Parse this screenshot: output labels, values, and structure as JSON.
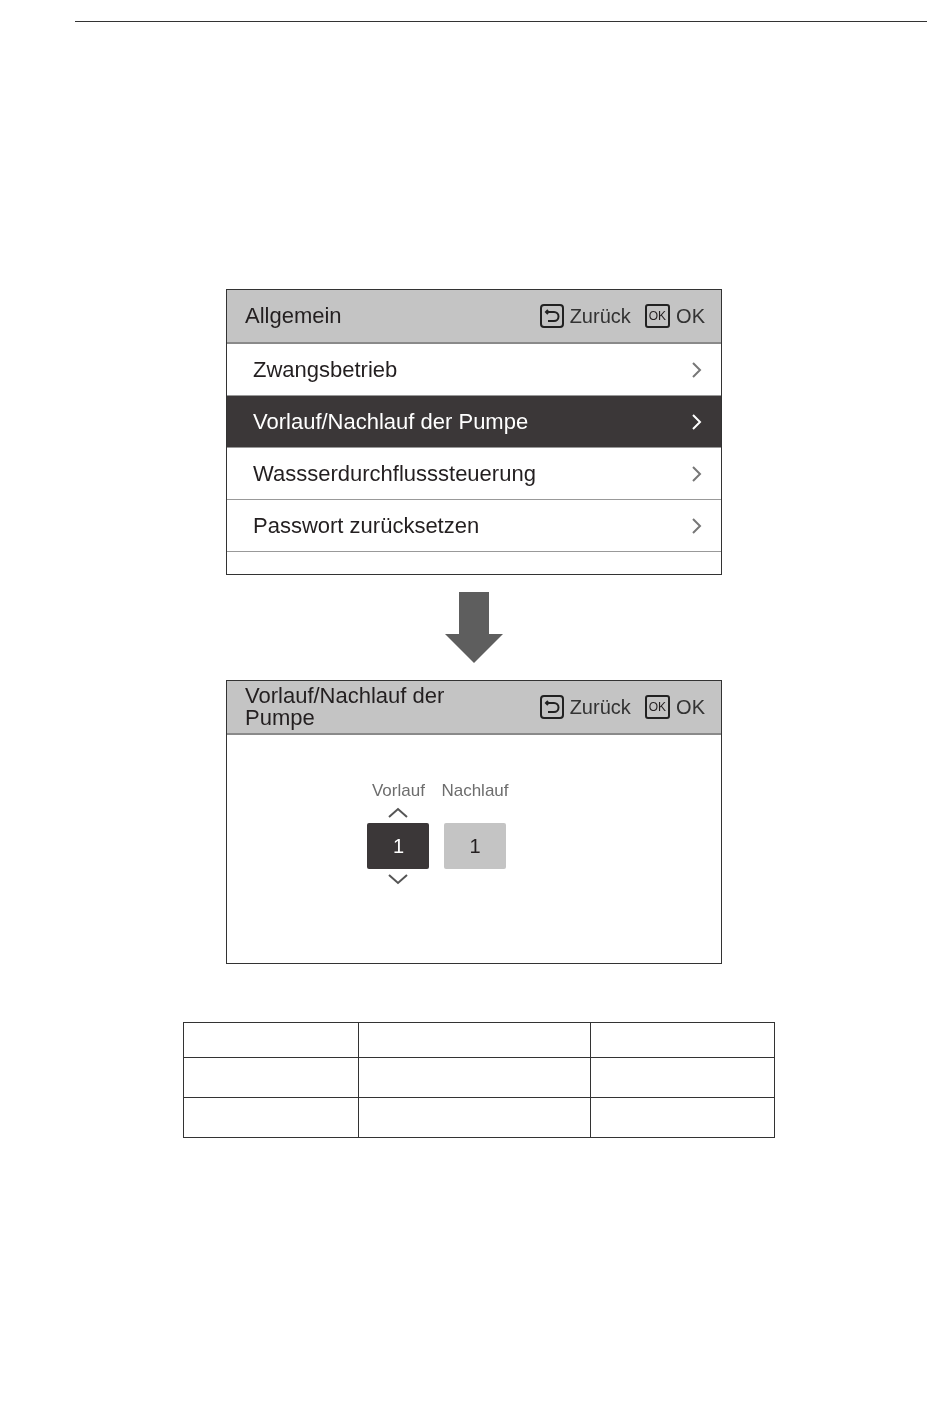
{
  "screens": [
    {
      "title": "Allgemein",
      "actions": [
        {
          "kind": "back",
          "label": "Zurück"
        },
        {
          "kind": "ok",
          "key": "OK",
          "label": "OK"
        }
      ],
      "menu": [
        {
          "label": "Zwangsbetrieb",
          "selected": false
        },
        {
          "label": "Vorlauf/Nachlauf der Pumpe",
          "selected": true
        },
        {
          "label": "Wassserdurchflusssteuerung",
          "selected": false
        },
        {
          "label": "Passwort zurücksetzen",
          "selected": false
        }
      ]
    },
    {
      "title": "Vorlauf/Nachlauf der Pumpe",
      "actions": [
        {
          "kind": "back",
          "label": "Zurück"
        },
        {
          "kind": "ok",
          "key": "OK",
          "label": "OK"
        }
      ],
      "spinners": [
        {
          "label": "Vorlauf",
          "value": "1",
          "selected": true
        },
        {
          "label": "Nachlauf",
          "value": "1",
          "selected": false
        }
      ]
    }
  ],
  "table": {
    "rows": [
      {
        "cells": [
          {},
          {},
          {}
        ]
      },
      {
        "cells": [
          {},
          {},
          {}
        ]
      },
      {
        "cells": [
          {},
          {},
          {}
        ]
      }
    ]
  }
}
